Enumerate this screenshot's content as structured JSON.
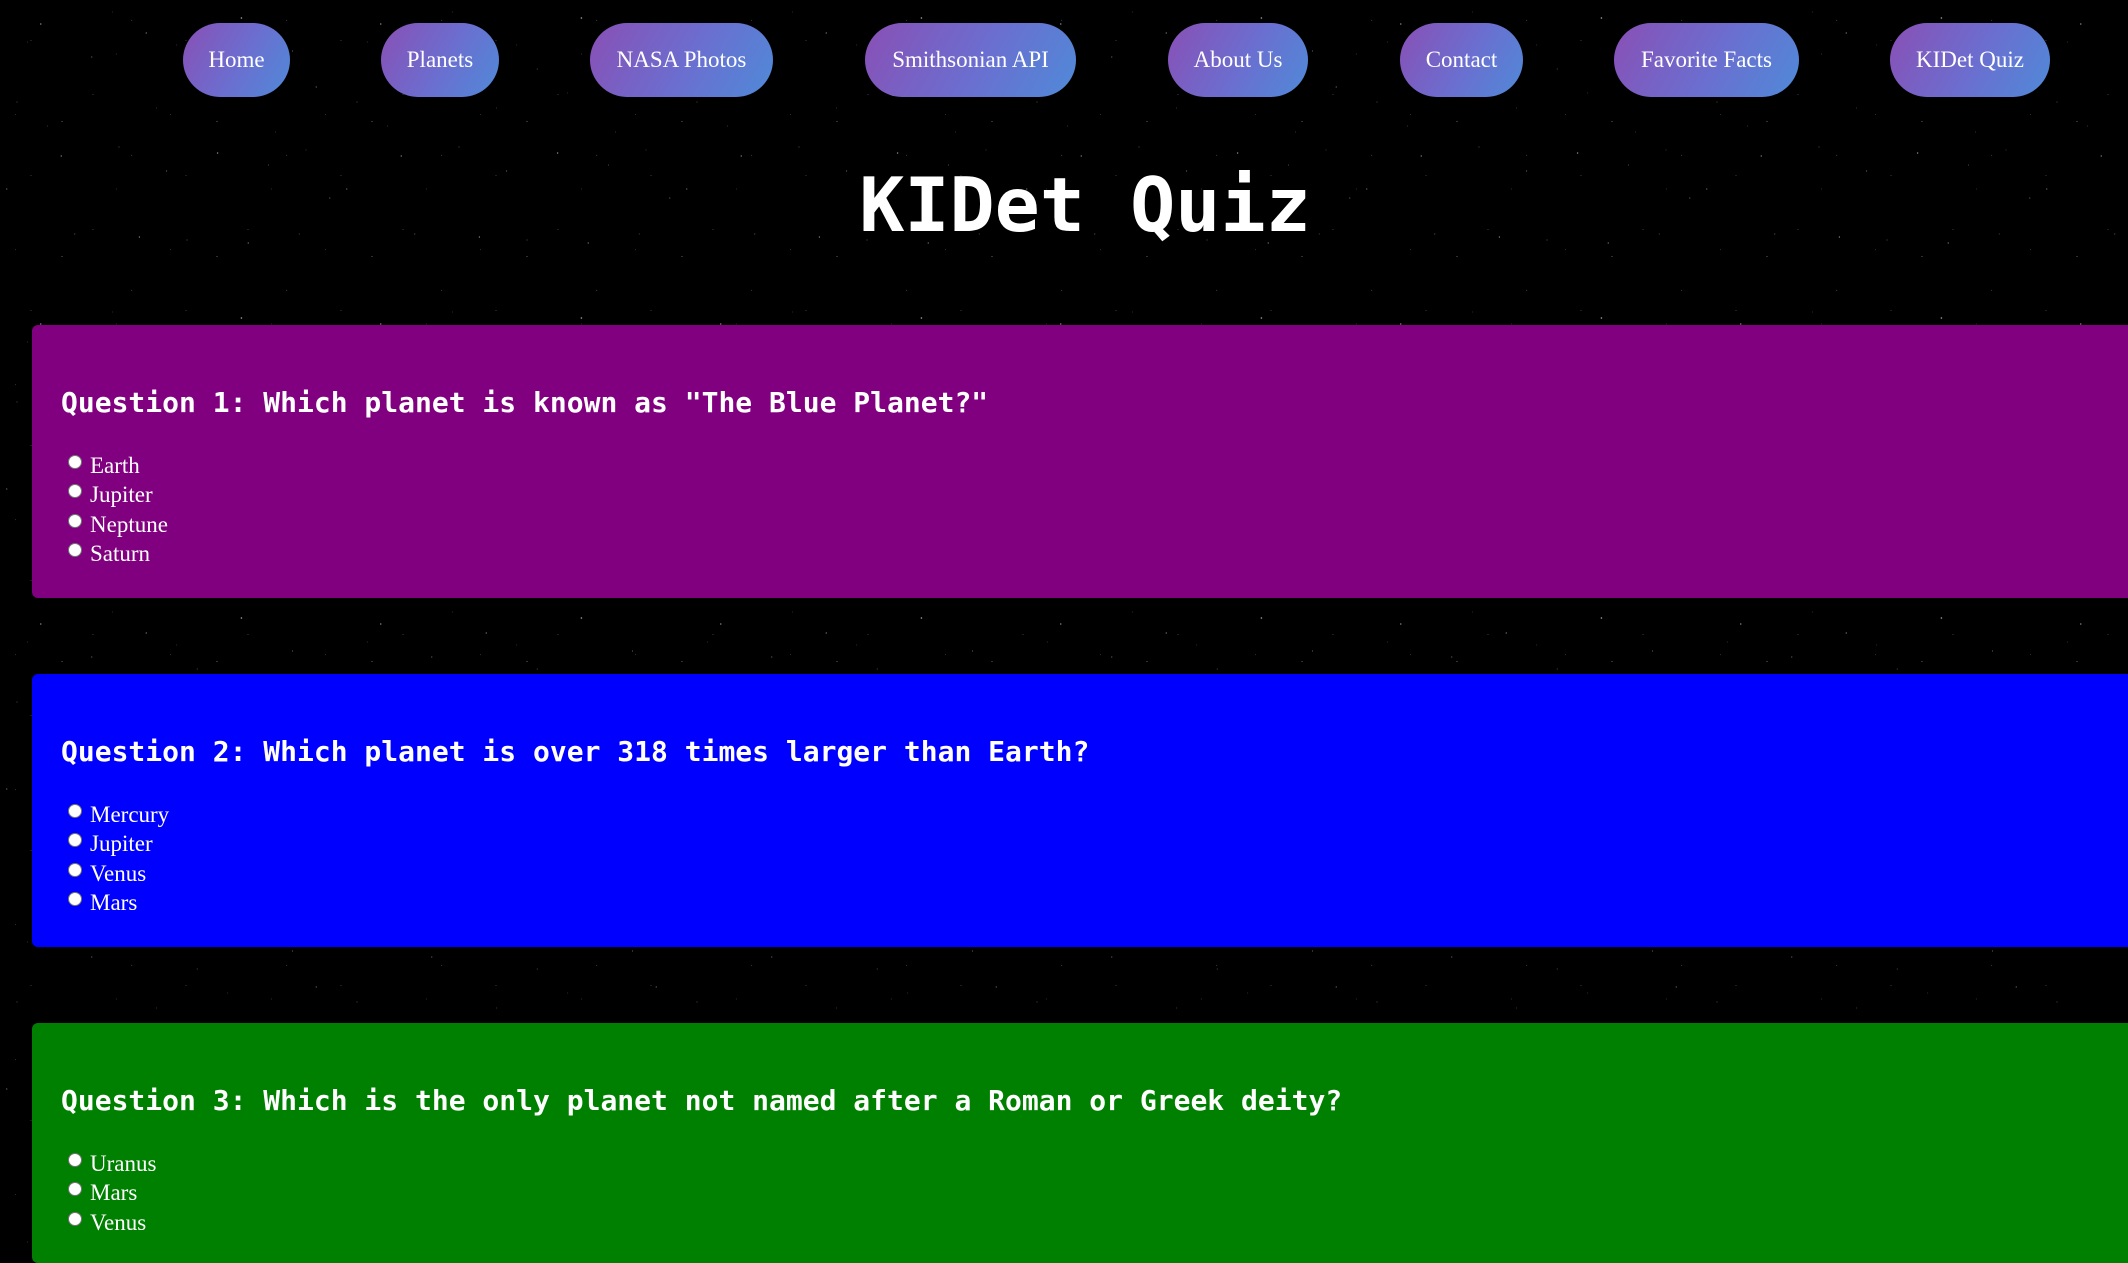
{
  "colors": {
    "background": "#000000",
    "nav_gradient_start": "#8a4fb5",
    "nav_gradient_end": "#4f8ad8",
    "question_1_bg": "#800080",
    "question_2_bg": "#0000ff",
    "question_3_bg": "#008000",
    "text": "#ffffff"
  },
  "nav": {
    "items": [
      {
        "label": "Home"
      },
      {
        "label": "Planets"
      },
      {
        "label": "NASA Photos"
      },
      {
        "label": "Smithsonian API"
      },
      {
        "label": "About Us"
      },
      {
        "label": "Contact"
      },
      {
        "label": "Favorite Facts"
      },
      {
        "label": "KIDet Quiz"
      }
    ]
  },
  "page": {
    "title": "KIDet Quiz"
  },
  "questions": [
    {
      "text": "Question 1: Which planet is known as \"The Blue Planet?\"",
      "color": "#800080",
      "options": [
        "Earth",
        "Jupiter",
        "Neptune",
        "Saturn"
      ]
    },
    {
      "text": "Question 2: Which planet is over 318 times larger than Earth?",
      "color": "#0000ff",
      "options": [
        "Mercury",
        "Jupiter",
        "Venus",
        "Mars"
      ]
    },
    {
      "text": "Question 3: Which is the only planet not named after a Roman or Greek deity?",
      "color": "#008000",
      "options": [
        "Uranus",
        "Mars",
        "Venus"
      ]
    }
  ]
}
